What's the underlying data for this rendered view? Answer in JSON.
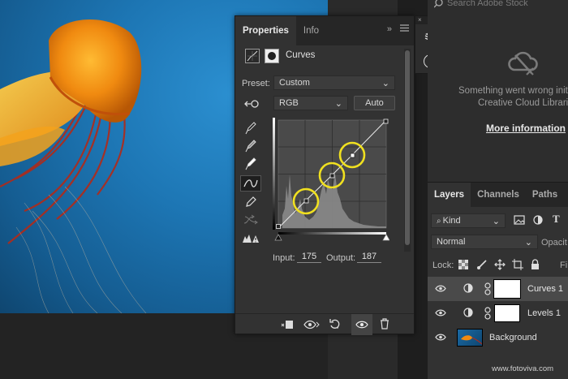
{
  "properties": {
    "tabs": [
      {
        "label": "Properties"
      },
      {
        "label": "Info"
      }
    ],
    "collapse_label": "»",
    "adjustment_name": "Curves",
    "preset_label": "Preset:",
    "preset_value": "Custom",
    "channel_value": "RGB",
    "auto_label": "Auto",
    "input_label": "Input:",
    "input_value": "175",
    "output_label": "Output:",
    "output_value": "187"
  },
  "stock": {
    "search_placeholder": "Search Adobe Stock",
    "error_line1": "Something went wrong initi",
    "error_line2": "Creative Cloud Librarie",
    "more_info": "More information"
  },
  "layers": {
    "tabs": [
      {
        "label": "Layers"
      },
      {
        "label": "Channels"
      },
      {
        "label": "Paths"
      }
    ],
    "filter_value": "Kind",
    "blend_mode": "Normal",
    "opacity_label": "Opacit",
    "lock_label": "Lock:",
    "fill_label": "Fi",
    "rows": [
      {
        "name": "Curves 1"
      },
      {
        "name": "Levels 1"
      },
      {
        "name": "Background"
      }
    ]
  },
  "watermark": "www.fotoviva.com",
  "colors": {
    "accent_highlight": "#f0e020",
    "panel_bg": "#323232",
    "canvas_blue": "#1d76b4"
  }
}
